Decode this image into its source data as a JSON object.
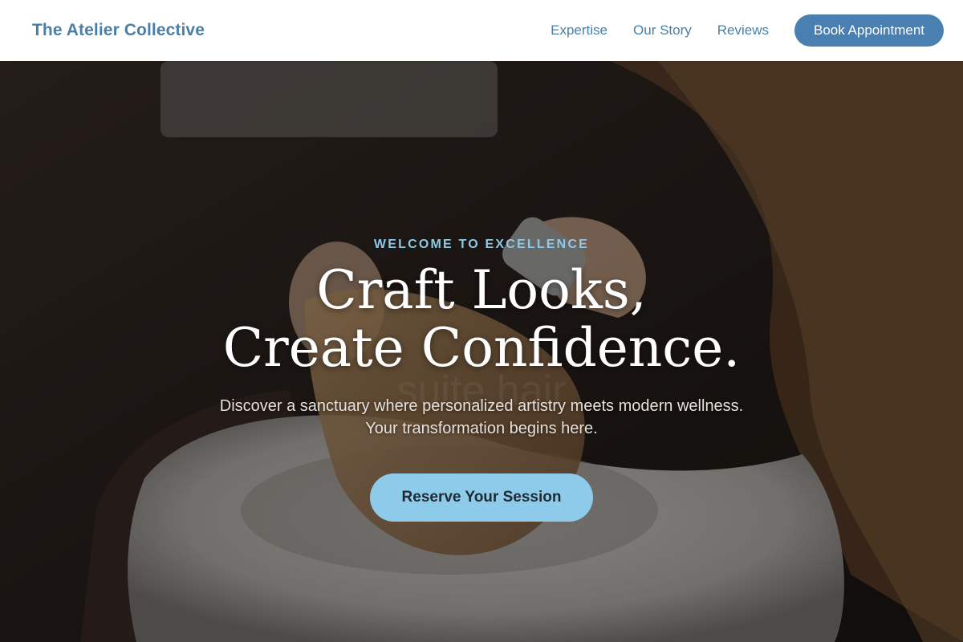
{
  "header": {
    "brand": "The Atelier Collective",
    "nav": [
      {
        "label": "Expertise"
      },
      {
        "label": "Our Story"
      },
      {
        "label": "Reviews"
      }
    ],
    "book_label": "Book Appointment"
  },
  "hero": {
    "eyebrow": "WELCOME TO EXCELLENCE",
    "headline_line1": "Craft Looks,",
    "headline_line2": "Create Confidence.",
    "subtext": "Discover a sanctuary where personalized artistry meets modern wellness. Your transformation begins here.",
    "cta_label": "Reserve Your Session",
    "background_image": "salon hair wash photo"
  },
  "colors": {
    "brand": "#4a7fa8",
    "button_primary": "#4a7fb1",
    "accent_light_blue": "#8ecbea",
    "header_bg": "#ffffff"
  }
}
